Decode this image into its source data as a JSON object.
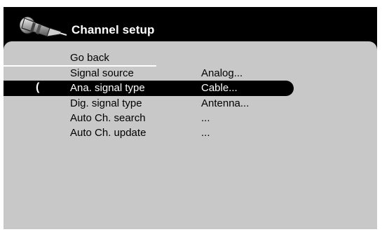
{
  "menu": {
    "title": "Channel setup",
    "icon": "antenna-connector-icon",
    "selected_marker": "(",
    "items": [
      {
        "label": "Go back",
        "value": ""
      },
      {
        "label": "Signal source",
        "value": "Analog..."
      },
      {
        "label": "Ana. signal type",
        "value": "Cable..."
      },
      {
        "label": "Dig. signal type",
        "value": "Antenna..."
      },
      {
        "label": "Auto Ch. search",
        "value": "..."
      },
      {
        "label": "Auto Ch. update",
        "value": "..."
      }
    ],
    "selected_index": 2
  },
  "colors": {
    "background": "#000000",
    "panel": "#c8c8c8",
    "highlight": "#000000",
    "text": "#000000",
    "highlight_text": "#ffffff"
  }
}
